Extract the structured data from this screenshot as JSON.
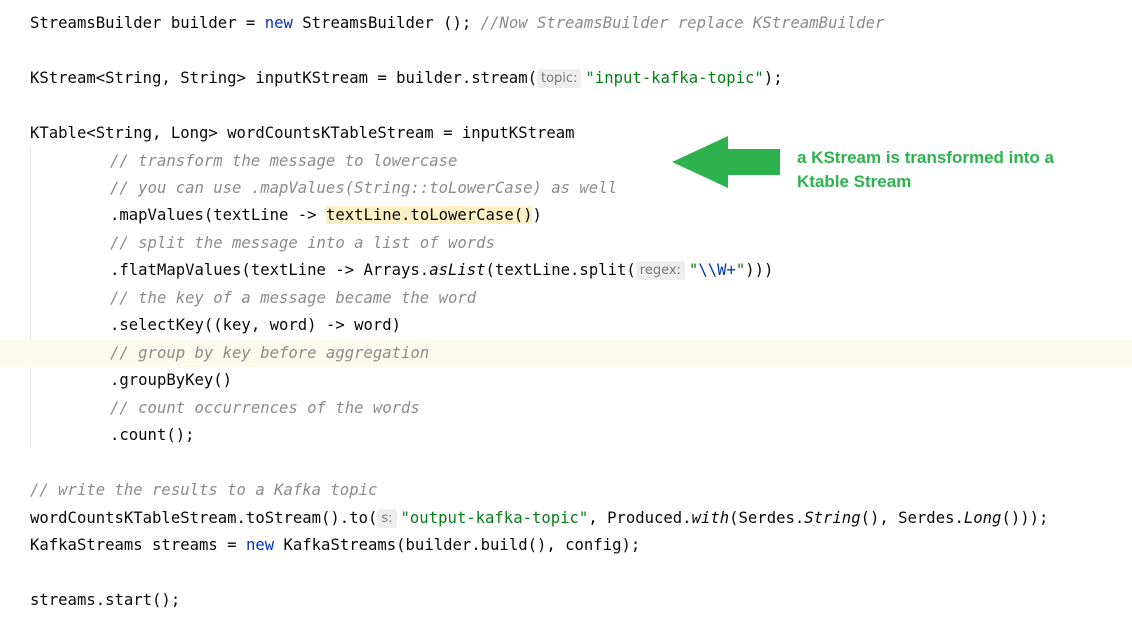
{
  "colors": {
    "background": "#ffffff",
    "keyword": "#0033b3",
    "string": "#067d17",
    "comment": "#8c8c8c",
    "annotation": "#2eb24e",
    "current_line": "#fcfaed",
    "highlight": "#fcf0c7"
  },
  "annotation": {
    "icon": "left-arrow-icon",
    "text": "a KStream is transformed into a Ktable Stream"
  },
  "code": {
    "line1": {
      "a": "StreamsBuilder builder = ",
      "kw": "new",
      "b": " StreamsBuilder (); ",
      "comment": "//Now StreamsBuilder replace KStreamBuilder"
    },
    "line2": {
      "a": "KStream<String, String> inputKStream = builder.stream(",
      "hint": "topic:",
      "str": "\"input-kafka-topic\"",
      "b": ");"
    },
    "line3": {
      "a": "KTable<String, Long> wordCountsKTableStream = inputKStream"
    },
    "line4": {
      "comment": "// transform the message to lowercase"
    },
    "line5": {
      "comment": "// you can use .mapValues(String::toLowerCase) as well"
    },
    "line6": {
      "a": ".mapValues(textLine -> ",
      "hl": "textLine.toLowerCase()",
      "b": ")"
    },
    "line7": {
      "comment": "// split the message into a list of words"
    },
    "line8": {
      "a": ".flatMapValues(textLine -> Arrays.",
      "it": "asList",
      "b": "(textLine.split(",
      "hint": "regex:",
      "str1": "\"",
      "esc": "\\\\W+",
      "str2": "\"",
      "c": ")))"
    },
    "line9": {
      "comment": "// the key of a message became the word"
    },
    "line10": {
      "a": ".selectKey((key, word) -> word)"
    },
    "line11": {
      "comment": "// group by key before aggregation"
    },
    "line12": {
      "a": ".groupByKey()"
    },
    "line13": {
      "comment": "// count occurrences of the words"
    },
    "line14": {
      "a": ".count();"
    },
    "line15": {
      "comment": "// write the results to a Kafka topic"
    },
    "line16": {
      "a": "wordCountsKTableStream.toStream().to(",
      "hint": "s:",
      "str": "\"output-kafka-topic\"",
      "b": ", Produced.",
      "it1": "with",
      "c": "(Serdes.",
      "it2": "String",
      "d": "(), Serdes.",
      "it3": "Long",
      "e": "()));"
    },
    "line17": {
      "a": "KafkaStreams streams = ",
      "kw": "new",
      "b": " KafkaStreams(builder.build(), config);"
    },
    "line18": {
      "a": "streams.start();"
    }
  }
}
